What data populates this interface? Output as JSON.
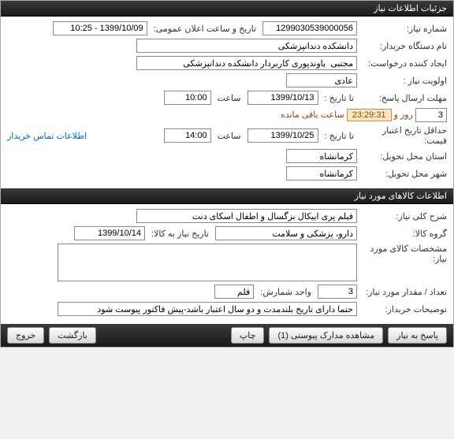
{
  "section1": {
    "title": "جزئیات اطلاعات نیاز",
    "need_no_label": "شماره نیاز:",
    "need_no": "1299030539000056",
    "announce_label": "تاریخ و ساعت اعلان عمومی:",
    "announce_value": "1399/10/09 - 10:25",
    "buyer_label": "نام دستگاه خریدار:",
    "buyer": "دانشکده دندانپزشکی",
    "creator_label": "ایجاد کننده درخواست:",
    "creator": "مجتبی  یاوندپوری کاربردار دانشکده دندانپزشکی",
    "priority_label": "اولویت نیاز :",
    "priority": "عادی",
    "deadline_label": "مهلت ارسال پاسخ:",
    "to_date_label": "تا تاریخ :",
    "to_date": "1399/10/13",
    "hour_label": "ساعت",
    "to_time": "10:00",
    "days_left": "3",
    "days_word": "روز و",
    "time_left": "23:29:31",
    "remain_suffix": "ساعت باقی مانده",
    "contact_link": "اطلاعات تماس خریدار",
    "min_credit_label": "حداقل تاریخ اعتبار قیمت:",
    "min_to_date": "1399/10/25",
    "min_to_time": "14:00",
    "province_label": "استان محل تحویل:",
    "province": "کرمانشاه",
    "city_label": "شهر محل تحویل:",
    "city": "کرمانشاه"
  },
  "section2": {
    "title": "اطلاعات کالاهای مورد نیاز",
    "desc_label": "شرح کلی نیاز:",
    "desc": "فیلم پری اییکال بزگسال و اطفال اسکای دنت",
    "group_label": "گروه کالا:",
    "group": "دارو، پزشکی و سلامت",
    "need_date_label": "تاریخ نیاز به کالا:",
    "need_date": "1399/10/14",
    "spec_label": "مشخصات کالای مورد نیاز:",
    "spec": "",
    "qty_label": "تعداد / مقدار مورد نیاز:",
    "qty": "3",
    "unit_label": "واحد شمارش:",
    "unit": "قلم",
    "note_label": "توضیحات خریدار:",
    "note": "حتما دارای تاریخ بلندمدت و دو سال اعتبار باشد-پیش فاکتور پیوست شود"
  },
  "buttons": {
    "reply": "پاسخ به نیاز",
    "attachments": "مشاهده مدارک پیوستی  (1)",
    "print": "چاپ",
    "back": "بازگشت",
    "exit": "خروج"
  }
}
